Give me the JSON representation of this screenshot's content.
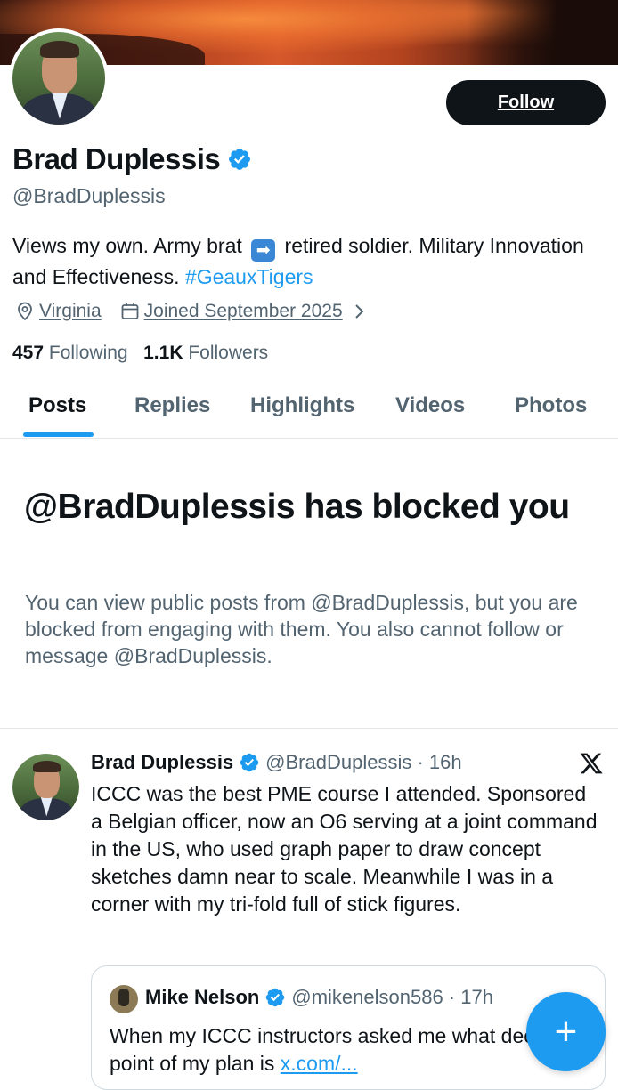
{
  "profile": {
    "follow_label": "Follow",
    "name": "Brad Duplessis",
    "handle": "@BradDuplessis",
    "bio_part1": "Views my own. Army brat",
    "bio_emoji": "➡",
    "bio_part2": "retired soldier. Military Innovation and Effectiveness.",
    "bio_hashtag": "#GeauxTigers",
    "location": "Virginia",
    "joined": "Joined September 2025",
    "following_count": "457",
    "following_label": "Following",
    "followers_count": "1.1K",
    "followers_label": "Followers",
    "verified_color": "#1d9bf0"
  },
  "tabs": [
    "Posts",
    "Replies",
    "Highlights",
    "Videos",
    "Photos"
  ],
  "blocked": {
    "title": "@BradDuplessis has blocked you",
    "description": "You can view public posts from @BradDuplessis, but you are blocked from engaging with them. You also cannot follow or message @BradDuplessis."
  },
  "post": {
    "name": "Brad Duplessis",
    "handle_time": "@BradDuplessis · 16h",
    "text": "ICCC was the best PME course I attended. Sponsored a Belgian officer, now an O6 serving at a joint command in the US, who used graph paper to draw concept sketches damn near to scale. Meanwhile I was in a corner with my tri-fold full of stick figures.",
    "quote": {
      "name": "Mike Nelson",
      "handle_time": "@mikenelson586 · 17h",
      "text": "When my ICCC instructors asked me what decisive point of my plan is",
      "link": "x.com/..."
    }
  },
  "fab_label": "+"
}
